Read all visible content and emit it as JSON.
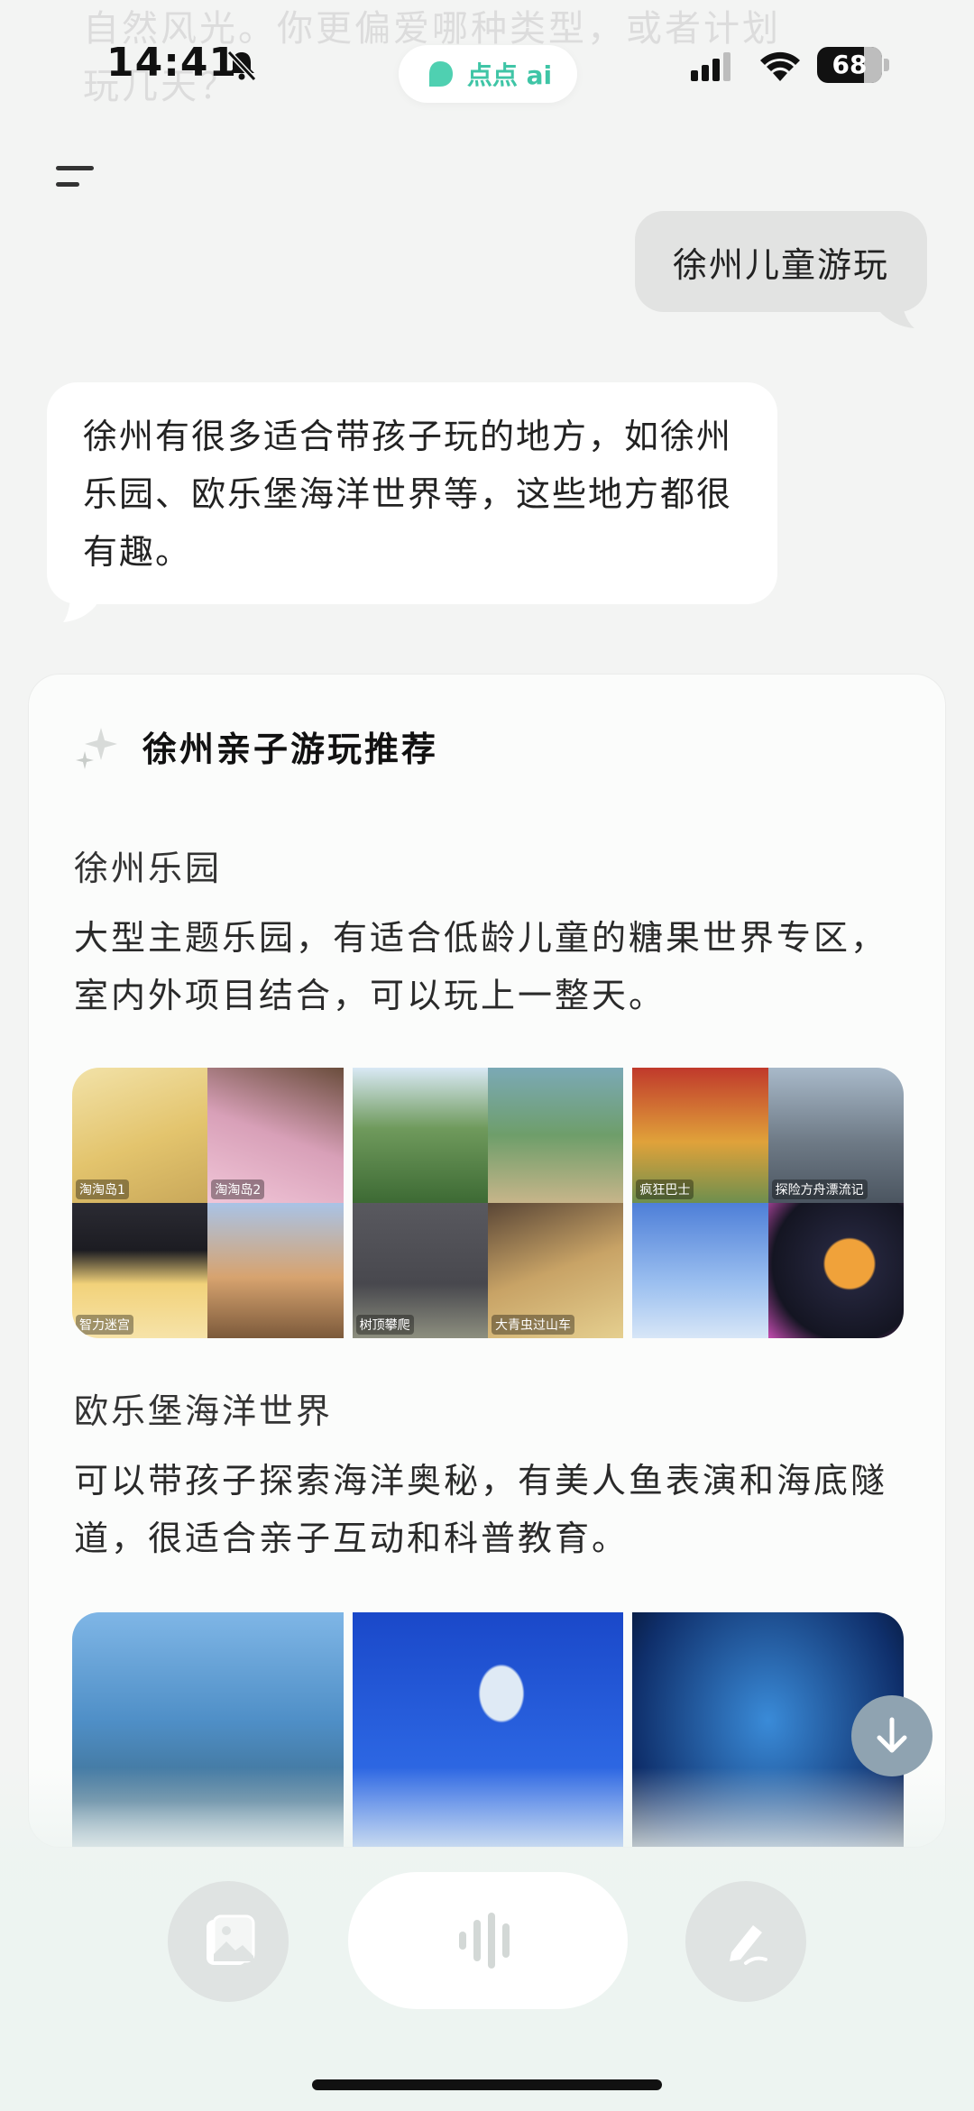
{
  "previous_message_fragment": "自然风光。你更偏爱哪种类型，或者计划玩几天？",
  "status_bar": {
    "time": "14:41",
    "battery": "68",
    "app_pill_label": "点点 ai"
  },
  "chat": {
    "user_message": "徐州儿童游玩",
    "assistant_message": "徐州有很多适合带孩子玩的地方，如徐州乐园、欧乐堡海洋世界等，这些地方都很有趣。"
  },
  "card": {
    "title": "徐州亲子游玩推荐",
    "places": [
      {
        "name": "徐州乐园",
        "description": "大型主题乐园，有适合低龄儿童的糖果世界专区，室内外项目结合，可以玩上一整天。",
        "photo_tags": [
          "淘淘岛1",
          "淘淘岛2",
          "智力迷宫",
          "树顶攀爬",
          "大青虫过山车",
          "疯狂巴士",
          "探险方舟漂流记"
        ]
      },
      {
        "name": "欧乐堡海洋世界",
        "description": "可以带孩子探索海洋奥秘，有美人鱼表演和海底隧道，很适合亲子互动和科普教育。"
      }
    ]
  },
  "icons": {
    "menu": "menu-icon",
    "bell_off": "bell-off-icon",
    "scroll_down": "arrow-down-icon",
    "image": "image-icon",
    "voice": "voice-wave-icon",
    "write": "pen-icon"
  },
  "colors": {
    "accent": "#3fc5a6",
    "scroll_button": "#8fa3b1"
  }
}
